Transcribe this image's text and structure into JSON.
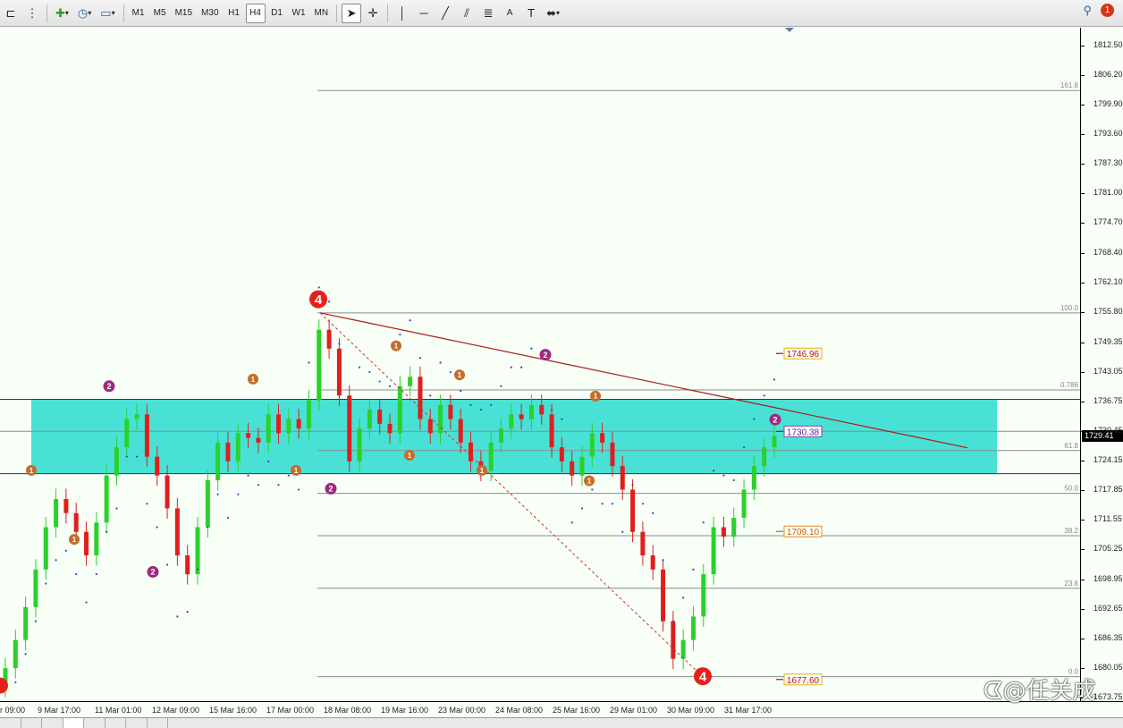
{
  "toolbar": {
    "timeframes": [
      "M1",
      "M5",
      "M15",
      "M30",
      "H1",
      "H4",
      "D1",
      "W1",
      "MN"
    ],
    "active_timeframe": "H4",
    "notification_count": "1",
    "text_tool_label": "A"
  },
  "price_axis": {
    "labels": [
      "1812.50",
      "1806.20",
      "1799.90",
      "1793.60",
      "1787.30",
      "1781.00",
      "1774.70",
      "1768.40",
      "1762.10",
      "1755.80",
      "1749.35",
      "1743.05",
      "1736.75",
      "1730.45",
      "1724.15",
      "1717.85",
      "1711.55",
      "1705.25",
      "1698.95",
      "1692.65",
      "1686.35",
      "1680.05",
      "1673.75"
    ],
    "current_price": "1729.41"
  },
  "time_axis": {
    "labels": [
      "r 09:00",
      "9 Mar 17:00",
      "11 Mar 01:00",
      "12 Mar 09:00",
      "15 Mar 16:00",
      "17 Mar 00:00",
      "18 Mar 08:00",
      "19 Mar 16:00",
      "23 Mar 00:00",
      "24 Mar 08:00",
      "25 Mar 16:00",
      "29 Mar 01:00",
      "30 Mar 09:00",
      "31 Mar 17:00"
    ]
  },
  "fibonacci": {
    "levels": [
      {
        "label": "161.8",
        "price": 1802.9
      },
      {
        "label": "100.0",
        "price": 1755.6
      },
      {
        "label": "0.786",
        "price": 1739.2
      },
      {
        "label": "61.8",
        "price": 1726.3
      },
      {
        "label": "50.0",
        "price": 1717.2
      },
      {
        "label": "38.2",
        "price": 1708.2
      },
      {
        "label": "23.6",
        "price": 1697.0
      },
      {
        "label": "0.0",
        "price": 1678.2
      }
    ]
  },
  "price_tags": [
    {
      "text": "1746.96",
      "price": 1746.96,
      "color": "#b01010",
      "box": "#e3b300"
    },
    {
      "text": "1730.38",
      "price": 1730.38,
      "color": "#6a2090",
      "box": "#7a4ab0"
    },
    {
      "text": "1709.10",
      "price": 1709.1,
      "color": "#c06000",
      "box": "#e08a20"
    },
    {
      "text": "1677.60",
      "price": 1677.6,
      "color": "#b01010",
      "box": "#e3b300"
    }
  ],
  "wave_labels": [
    {
      "text": "4",
      "kind": "big",
      "time": 356,
      "price": 1758.5
    },
    {
      "text": "4",
      "kind": "big",
      "time": 786,
      "price": 1678.3
    },
    {
      "text": "2",
      "kind": "purple",
      "time": 122,
      "price": 1740.0
    },
    {
      "text": "2",
      "kind": "purple",
      "time": 171,
      "price": 1700.5
    },
    {
      "text": "2",
      "kind": "purple",
      "time": 370,
      "price": 1718.2
    },
    {
      "text": "2",
      "kind": "purple",
      "time": 610,
      "price": 1746.7
    },
    {
      "text": "2",
      "kind": "purple",
      "time": 867,
      "price": 1732.9
    },
    {
      "text": "1",
      "kind": "orange",
      "time": 35,
      "price": 1722.1
    },
    {
      "text": "1",
      "kind": "orange",
      "time": 83,
      "price": 1707.4
    },
    {
      "text": "1",
      "kind": "orange",
      "time": 283,
      "price": 1741.5
    },
    {
      "text": "1",
      "kind": "orange",
      "time": 331,
      "price": 1722.1
    },
    {
      "text": "1",
      "kind": "orange",
      "time": 443,
      "price": 1748.6
    },
    {
      "text": "1",
      "kind": "orange",
      "time": 458,
      "price": 1725.3
    },
    {
      "text": "1",
      "kind": "orange",
      "time": 514,
      "price": 1742.4
    },
    {
      "text": "1",
      "kind": "orange",
      "time": 539,
      "price": 1722.1
    },
    {
      "text": "1",
      "kind": "orange",
      "time": 666,
      "price": 1737.9
    },
    {
      "text": "1",
      "kind": "orange",
      "time": 659,
      "price": 1719.9
    }
  ],
  "chart_data": {
    "type": "candlestick",
    "symbol_timeframe": "H4",
    "ylim": [
      1673.75,
      1815.5
    ],
    "zone": {
      "top": 1737.2,
      "bottom": 1721.4,
      "color": "#3fdfd3"
    },
    "zone_lines": [
      1737.2,
      1721.4
    ],
    "trendline": [
      {
        "x": 358,
        "y": 1755.6
      },
      {
        "x": 1082,
        "y": 1726.9
      }
    ],
    "colors": {
      "bull": "#2ad12a",
      "bear": "#e01e1e",
      "sar": "#4040c0"
    },
    "series_close": [
      1680,
      1686,
      1693,
      1701,
      1710,
      1716,
      1713,
      1709,
      1704,
      1711,
      1721,
      1727,
      1733,
      1734,
      1725,
      1721,
      1714,
      1704,
      1700,
      1710,
      1720,
      1728,
      1724,
      1730,
      1729,
      1728,
      1734,
      1730,
      1733,
      1731,
      1737,
      1752,
      1748,
      1738,
      1724,
      1731,
      1735,
      1732,
      1730,
      1740,
      1742,
      1733,
      1730,
      1736,
      1733,
      1728,
      1724,
      1722,
      1728,
      1731,
      1734,
      1733,
      1736,
      1734,
      1727,
      1724,
      1721,
      1725,
      1730,
      1728,
      1723,
      1718,
      1709,
      1704,
      1701,
      1690,
      1682,
      1686,
      1691,
      1700,
      1710,
      1708,
      1712,
      1718,
      1723,
      1727,
      1729.41
    ]
  }
}
